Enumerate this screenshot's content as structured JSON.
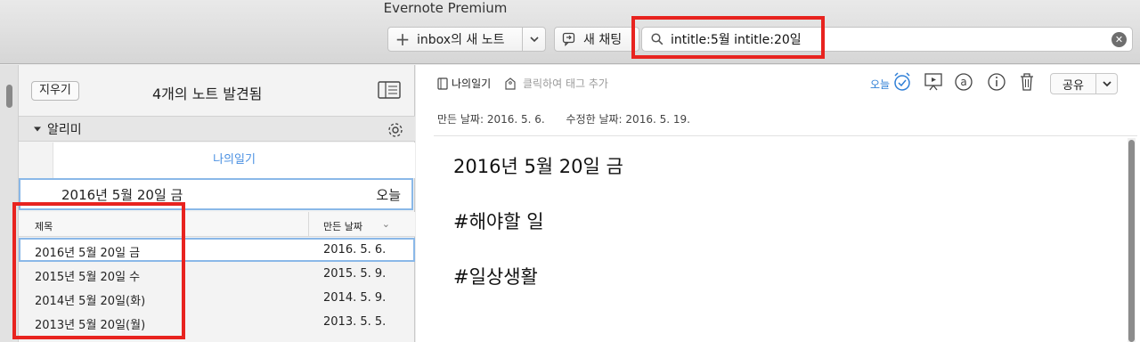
{
  "window": {
    "title": "Evernote Premium"
  },
  "toolbar": {
    "new_note_label": "inbox의 새 노트",
    "chat_label": "새 채팅",
    "search_value": "intitle:5월 intitle:20일"
  },
  "note_list": {
    "clear_label": "지우기",
    "found_count": "4개의 노트 발견됨",
    "section_label": "알리미",
    "notebook_label": "나의일기",
    "selected_note": {
      "title": "2016년 5월 20일 금",
      "when": "오늘"
    },
    "columns": {
      "title": "제목",
      "date": "만든 날짜"
    },
    "rows": [
      {
        "title": "2016년 5월 20일 금",
        "date": "2016. 5. 6."
      },
      {
        "title": "2015년 5월 20일 수",
        "date": "2015. 5. 9."
      },
      {
        "title": "2014년 5월 20일(화)",
        "date": "2014. 5. 9."
      },
      {
        "title": "2013년 5월 20일(월)",
        "date": "2013. 5. 5."
      }
    ]
  },
  "note_detail": {
    "notebook": "나의일기",
    "tag_placeholder": "클릭하여 태그 추가",
    "reminder_label": "오늘",
    "share_label": "공유",
    "created": "만든 날짜: 2016. 5. 6.",
    "updated": "수정한 날짜: 2016. 5. 19.",
    "body": [
      "2016년 5월 20일 금",
      "#해야할 일",
      "#일상생활"
    ]
  },
  "colors": {
    "highlight_frame": "#e8231f",
    "accent": "#2f7fd6",
    "selection": "#8ab8e8"
  },
  "icons": [
    "plus-icon",
    "chevron-down-icon",
    "chat-icon",
    "search-icon",
    "clear-search-icon",
    "layout-icon",
    "gear-icon",
    "notebook-icon",
    "tag-icon",
    "alarm-icon",
    "present-icon",
    "at-icon",
    "info-icon",
    "trash-icon"
  ]
}
